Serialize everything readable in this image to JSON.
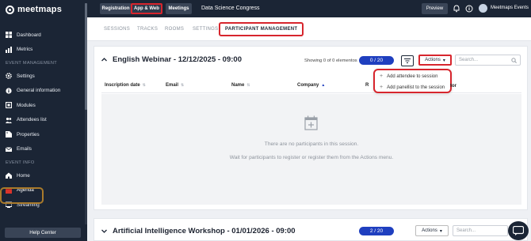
{
  "brand": {
    "name": "meetmaps"
  },
  "sidebar": {
    "items": [
      {
        "label": "Dashboard",
        "icon": "dashboard-icon"
      },
      {
        "label": "Metrics",
        "icon": "metrics-icon"
      }
    ],
    "section_event": "EVENT MANAGEMENT",
    "event_items": [
      {
        "label": "Settings",
        "icon": "gear-icon"
      },
      {
        "label": "General information",
        "icon": "info-icon"
      },
      {
        "label": "Modules",
        "icon": "modules-icon"
      },
      {
        "label": "Attendees list",
        "icon": "users-icon"
      },
      {
        "label": "Properties",
        "icon": "properties-icon"
      },
      {
        "label": "Emails",
        "icon": "mail-icon"
      }
    ],
    "section_info": "EVENT INFO",
    "info_items": [
      {
        "label": "Home",
        "icon": "home-icon"
      },
      {
        "label": "Agenda",
        "icon": "calendar-icon"
      },
      {
        "label": "Streaming",
        "icon": "streaming-icon"
      }
    ],
    "help": "Help Center"
  },
  "topbar": {
    "buttons": [
      "Registration",
      "App & Web",
      "Meetings"
    ],
    "event_name": "Data Science Congress",
    "preview": "Preview",
    "user": "Meetmaps Events"
  },
  "tabs": [
    "SESSIONS",
    "TRACKS",
    "ROOMS",
    "SETTINGS",
    "PARTICIPANT MANAGEMENT"
  ],
  "session1": {
    "title": "English Webinar - 12/12/2025 - 09:00",
    "showing": "Showing 0 of 0 elementos",
    "count": "0 / 20",
    "actions": "Actions",
    "search_placeholder": "Search...",
    "columns": [
      "Inscription date",
      "Email",
      "Name",
      "Company",
      "R"
    ],
    "last_column": "tor",
    "empty_line1": "There are no participants in this session.",
    "empty_line2": "Wait for participants to register or register them from the Actions menu.",
    "menu": [
      "Add attendee to session",
      "Add panellist to the session"
    ]
  },
  "session2": {
    "title": "Artificial Intelligence Workshop - 01/01/2026 - 09:00",
    "count": "2 / 20",
    "actions": "Actions",
    "search_placeholder": "Search..."
  },
  "colors": {
    "accent": "#1f3fbf",
    "highlight": "#d7252d",
    "sidebar": "#1b2535"
  }
}
